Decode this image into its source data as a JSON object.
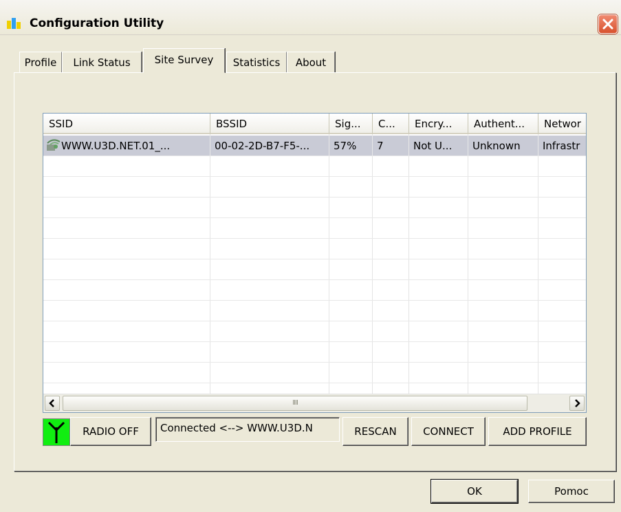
{
  "window": {
    "title": "Configuration Utility"
  },
  "tabs": [
    {
      "label": "Profile"
    },
    {
      "label": "Link Status"
    },
    {
      "label": "Site Survey",
      "active": true
    },
    {
      "label": "Statistics"
    },
    {
      "label": "About"
    }
  ],
  "site_survey": {
    "columns": [
      "SSID",
      "BSSID",
      "Sig...",
      "C...",
      "Encry...",
      "Authent...",
      "Networ"
    ],
    "rows": [
      {
        "ssid": "WWW.U3D.NET.01_...",
        "bssid": "00-02-2D-B7-F5-...",
        "signal": "57%",
        "channel": "7",
        "encryption": "Not U...",
        "authentication": "Unknown",
        "network": "Infrastr",
        "selected": true
      }
    ],
    "scrollbar_thumb_grip": "IIII"
  },
  "controls": {
    "radio_off_label": "RADIO OFF",
    "status_text": "Connected <--> WWW.U3D.N",
    "rescan_label": "RESCAN",
    "connect_label": "CONNECT",
    "add_profile_label": "ADD PROFILE"
  },
  "dialog": {
    "ok_label": "OK",
    "help_label": "Pomoc"
  },
  "colors": {
    "radio_indicator": "#11ee11",
    "selected_row": "#c9cbd6",
    "close_button": "#d8522e"
  }
}
